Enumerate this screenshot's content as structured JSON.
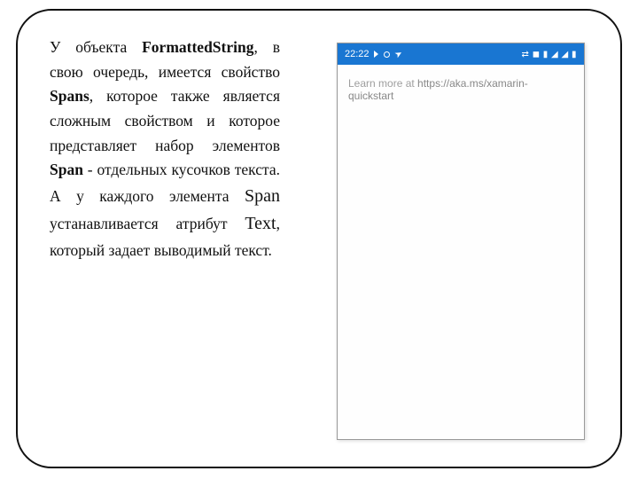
{
  "text": {
    "p1a": "У объекта ",
    "p1_bold1": "FormattedString",
    "p1b": ", в свою очередь, имеется свойство ",
    "p1_bold2": "Spans",
    "p1c": ", которое также является сложным свойством и которое представляет набор элементов ",
    "p1_bold3": "Span",
    "p1_dash": " -",
    "p2a": "отдельных кусочков текста. А у каждого элемента ",
    "p2_span": "Span",
    "p2b": " устанавливается атрибут ",
    "p2_text": "Text",
    "p2c": ", который задает выводимый текст."
  },
  "phone": {
    "time": "22:22",
    "status_icons_right": "⇄ ◼ ▮ ◢ ◢ ▮",
    "learn_prefix": "Learn more at ",
    "learn_url": "https://aka.ms/xamarin-quickstart"
  }
}
